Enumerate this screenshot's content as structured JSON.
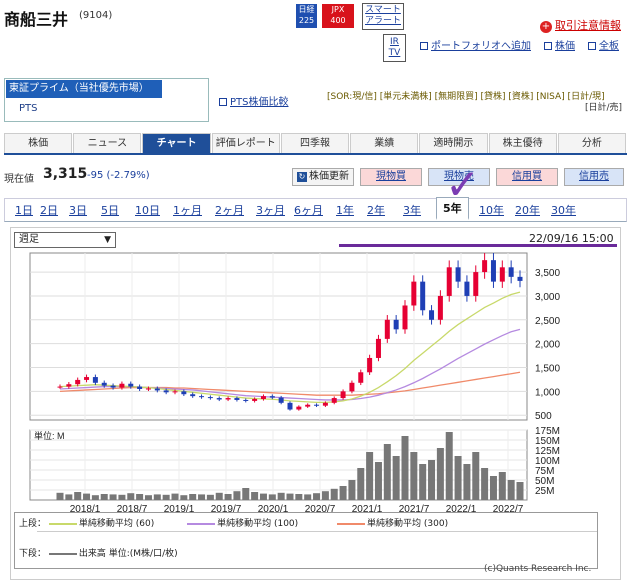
{
  "header": {
    "title": "商船三井",
    "code": "(9104)",
    "badges": {
      "nikkei": "日経\n225",
      "jpx": "JPX\n400",
      "smart_alert": "スマート\nアラート",
      "irtv": "IR\nTV"
    },
    "warning": "取引注意情報",
    "portfolio": "ポートフォリオへ追加",
    "stock_price": "株価",
    "full_board": "全板"
  },
  "market": {
    "selected": "東証プライム（当社優先市場）",
    "sub": "PTS",
    "pts_compare": "PTS株価比較",
    "legend": "[SOR:現/信] [単元未満株] [無期限買] [貸株] [資株] [NISA] [日計/現]",
    "legend2": "[日計/売]"
  },
  "tabs": [
    "株価",
    "ニュース",
    "チャート",
    "評価レポート",
    "四季報",
    "業績",
    "適時開示",
    "株主優待",
    "分析"
  ],
  "active_tab": 2,
  "price": {
    "label": "現在値",
    "value": "3,315",
    "change": "-95 (-2.79%)",
    "buttons": [
      "株価更新",
      "現物買",
      "現物売",
      "信用買",
      "信用売"
    ]
  },
  "periods": [
    "1日",
    "2日",
    "3日",
    "5日",
    "10日",
    "1ヶ月",
    "2ヶ月",
    "3ヶ月",
    "6ヶ月",
    "1年",
    "2年",
    "3年",
    "5年",
    "10年",
    "20年",
    "30年"
  ],
  "active_period": 12,
  "chart_controls": {
    "interval": "週足",
    "datetime": "22/09/16 15:00"
  },
  "colors": {
    "accent": "#1f4f99",
    "up": "#e60033",
    "down": "#1f3fb5",
    "ma60": "#c8d96a",
    "ma100": "#b58ae0",
    "ma300": "#f08a6a",
    "volume": "#777777"
  },
  "chart_data": {
    "type": "line",
    "x_labels": [
      "2018/1",
      "2018/7",
      "2019/1",
      "2019/7",
      "2020/1",
      "2020/7",
      "2021/1",
      "2021/7",
      "2022/1",
      "2022/7"
    ],
    "price_axis": [
      "3,500",
      "3,000",
      "2,500",
      "2,000",
      "1,500",
      "1,000",
      "500"
    ],
    "price_ylim": [
      400,
      3900
    ],
    "volume_axis": [
      "175M",
      "150M",
      "125M",
      "100M",
      "75M",
      "50M",
      "25M"
    ],
    "volume_label": "単位: M",
    "price_series": [
      1100,
      1150,
      1240,
      1300,
      1180,
      1120,
      1080,
      1160,
      1100,
      1050,
      1060,
      1020,
      980,
      1000,
      940,
      900,
      880,
      860,
      830,
      860,
      820,
      800,
      840,
      900,
      870,
      760,
      620,
      680,
      720,
      700,
      760,
      860,
      1000,
      1180,
      1400,
      1700,
      2100,
      2500,
      2300,
      2800,
      3300,
      2700,
      2500,
      3000,
      3600,
      3300,
      3000,
      3500,
      3750,
      3300,
      3600,
      3400,
      3315
    ],
    "ma60": [
      1100,
      1110,
      1120,
      1130,
      1140,
      1130,
      1120,
      1110,
      1100,
      1090,
      1080,
      1060,
      1040,
      1020,
      1000,
      980,
      960,
      940,
      920,
      900,
      880,
      860,
      850,
      840,
      835,
      820,
      800,
      790,
      780,
      770,
      770,
      780,
      800,
      840,
      900,
      980,
      1080,
      1200,
      1330,
      1480,
      1650,
      1800,
      1950,
      2100,
      2260,
      2400,
      2520,
      2640,
      2760,
      2850,
      2950,
      3030,
      3080
    ],
    "ma100": [
      1050,
      1060,
      1070,
      1080,
      1090,
      1100,
      1100,
      1100,
      1100,
      1090,
      1080,
      1070,
      1060,
      1050,
      1040,
      1030,
      1010,
      990,
      970,
      950,
      930,
      910,
      900,
      890,
      880,
      870,
      860,
      850,
      840,
      830,
      820,
      820,
      820,
      830,
      850,
      880,
      920,
      970,
      1030,
      1100,
      1180,
      1270,
      1370,
      1470,
      1580,
      1690,
      1790,
      1890,
      1990,
      2080,
      2170,
      2250,
      2300
    ],
    "ma300": [
      1000,
      1010,
      1020,
      1030,
      1040,
      1050,
      1060,
      1070,
      1080,
      1080,
      1080,
      1080,
      1080,
      1070,
      1070,
      1060,
      1050,
      1040,
      1030,
      1020,
      1010,
      1000,
      990,
      980,
      970,
      960,
      950,
      940,
      930,
      920,
      920,
      920,
      920,
      920,
      930,
      940,
      950,
      970,
      990,
      1010,
      1040,
      1070,
      1100,
      1130,
      1160,
      1190,
      1220,
      1250,
      1280,
      1310,
      1340,
      1370,
      1400
    ],
    "volume": [
      18,
      14,
      20,
      16,
      12,
      15,
      14,
      13,
      17,
      15,
      12,
      14,
      13,
      16,
      12,
      15,
      14,
      13,
      18,
      15,
      22,
      30,
      20,
      16,
      14,
      18,
      16,
      15,
      14,
      17,
      22,
      28,
      35,
      50,
      80,
      120,
      95,
      140,
      110,
      160,
      120,
      90,
      100,
      130,
      170,
      110,
      90,
      120,
      80,
      60,
      70,
      50,
      45
    ],
    "volume_ylim": [
      0,
      175
    ]
  },
  "legend": {
    "upper_label": "上段：",
    "ma60": "単純移動平均 (60)",
    "ma100": "単純移動平均 (100)",
    "ma300": "単純移動平均 (300)",
    "lower_label": "下段：",
    "volume": "出来高 単位:(M株/口/枚)"
  },
  "copyright": "(c)Quants Research Inc."
}
